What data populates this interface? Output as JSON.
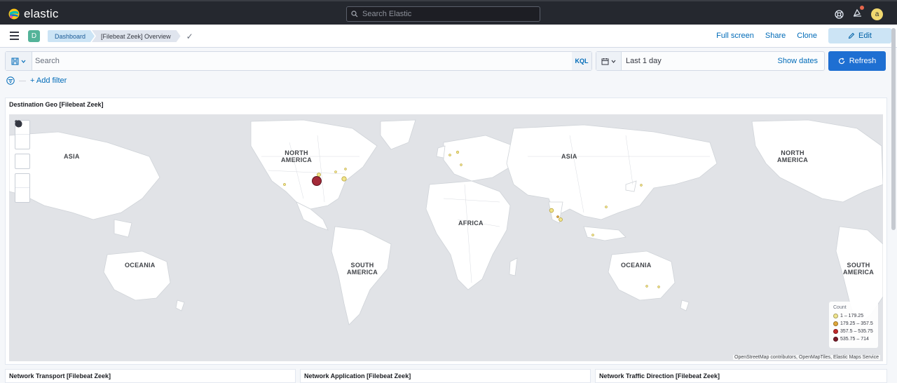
{
  "header": {
    "brand": "elastic",
    "search_placeholder": "Search Elastic",
    "avatar_initial": "a"
  },
  "navbar": {
    "space_initial": "D",
    "breadcrumbs": [
      "Dashboard",
      "[Filebeat Zeek] Overview"
    ],
    "actions": [
      "Full screen",
      "Share",
      "Clone"
    ],
    "edit_label": "Edit"
  },
  "query": {
    "placeholder": "Search",
    "language": "KQL",
    "time_range": "Last 1 day",
    "show_dates": "Show dates",
    "refresh_label": "Refresh",
    "add_filter": "+ Add filter"
  },
  "map_panel": {
    "title": "Destination Geo [Filebeat Zeek]",
    "labels": {
      "asia_left": "ASIA",
      "north_america_1": "NORTH\nAMERICA",
      "asia_right": "ASIA",
      "north_america_2": "NORTH\nAMERICA",
      "africa": "AFRICA",
      "oceania_left": "OCEANIA",
      "south_america_1": "SOUTH\nAMERICA",
      "oceania_right": "OCEANIA",
      "south_america_2": "SOUTH\nAMERICA"
    },
    "legend": {
      "title": "Count",
      "entries": [
        {
          "label": "1 – 179.25",
          "color": "#f1e58c"
        },
        {
          "label": "179.25 – 357.5",
          "color": "#e0a83a"
        },
        {
          "label": "357.5 – 535.75",
          "color": "#c1292a"
        },
        {
          "label": "535.75 – 714",
          "color": "#7a1a28"
        }
      ]
    },
    "attribution": "OpenStreetMap contributors, OpenMapTiles, Elastic Maps Service"
  },
  "bottom_panels": [
    "Network Transport [Filebeat Zeek]",
    "Network Application [Filebeat Zeek]",
    "Network Traffic Direction [Filebeat Zeek]"
  ],
  "colors": {
    "header_bg": "#25282f",
    "primary": "#1e6fd2",
    "link": "#006bb8",
    "map_water": "#e1e3e7",
    "map_land": "#ffffff"
  }
}
